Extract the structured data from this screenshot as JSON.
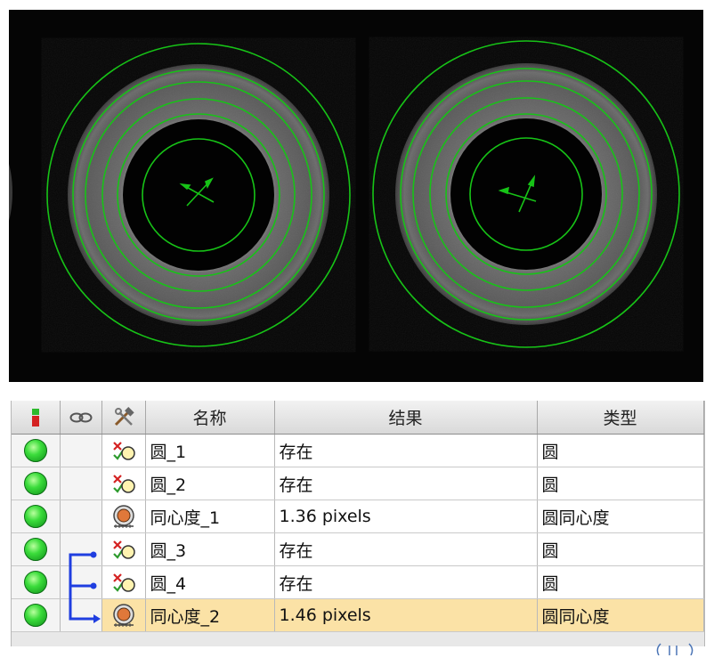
{
  "table": {
    "headers": {
      "status_icon": "status-icon",
      "link_icon": "link-icon",
      "tool_icon": "tools-icon",
      "name": "名称",
      "result": "结果",
      "type": "类型"
    },
    "rows": [
      {
        "name": "圆_1",
        "result": "存在",
        "type": "圆",
        "tool": "circle-tool-icon",
        "status": "pass"
      },
      {
        "name": "圆_2",
        "result": "存在",
        "type": "圆",
        "tool": "circle-tool-icon",
        "status": "pass"
      },
      {
        "name": "同心度_1",
        "result": "1.36 pixels",
        "type": "圆同心度",
        "tool": "concentricity-tool-icon",
        "status": "pass"
      },
      {
        "name": "圆_3",
        "result": "存在",
        "type": "圆",
        "tool": "circle-tool-icon",
        "status": "pass"
      },
      {
        "name": "圆_4",
        "result": "存在",
        "type": "圆",
        "tool": "circle-tool-icon",
        "status": "pass"
      },
      {
        "name": "同心度_2",
        "result": "1.46 pixels",
        "type": "圆同心度",
        "tool": "concentricity-tool-icon",
        "status": "pass",
        "selected": true
      }
    ]
  },
  "colors": {
    "overlay": "#17c317",
    "status_ok": "#3bdc3b",
    "link": "#1f3ee0",
    "selected_row": "#fbe2a6"
  }
}
